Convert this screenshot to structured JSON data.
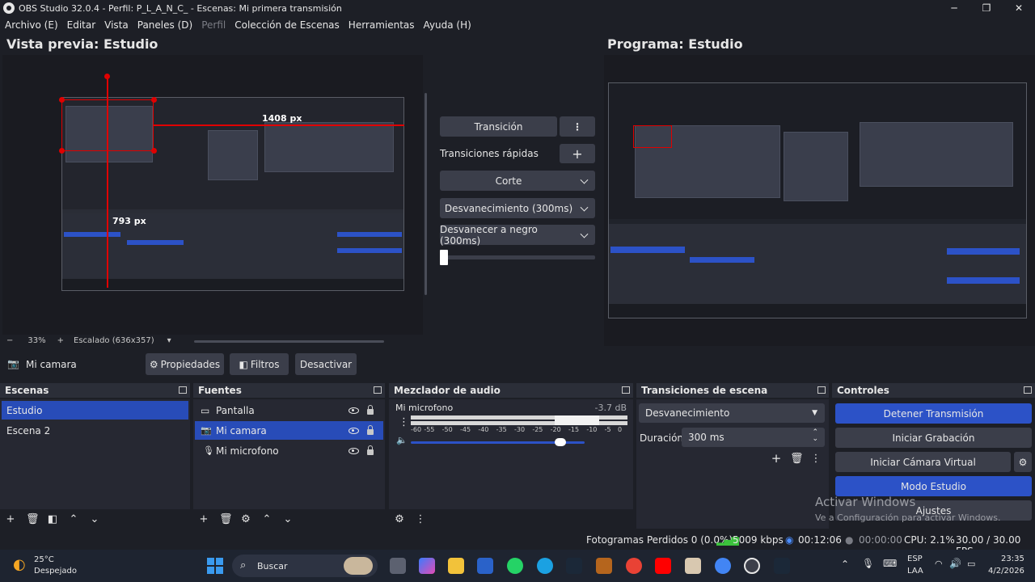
{
  "window": {
    "title": "OBS Studio 32.0.4 - Perfil: P_L_A_N_C_ - Escenas: Mi primera transmisión",
    "min": "─",
    "max": "❐",
    "close": "✕"
  },
  "menu": [
    "Archivo (E)",
    "Editar",
    "Vista",
    "Paneles (D)",
    "Perfil",
    "Colección de Escenas",
    "Herramientas",
    "Ayuda (H)"
  ],
  "preview": {
    "title": "Vista previa: Estudio",
    "width_label": "1408 px",
    "height_label": "793 px",
    "zoom_minus": "−",
    "zoom": "33%",
    "zoom_plus": "+",
    "scale": "Escalado (636x357)"
  },
  "program": {
    "title": "Programa: Estudio"
  },
  "transitions_center": {
    "transition_button": "Transición",
    "quick_label": "Transiciones rápidas",
    "quick": [
      "Corte",
      "Desvanecimiento (300ms)",
      "Desvanecer a negro (300ms)"
    ]
  },
  "source_toolbar": {
    "source_name": "Mi camara",
    "properties": "Propiedades",
    "filters": "Filtros",
    "deactivate": "Desactivar"
  },
  "scenes": {
    "title": "Escenas",
    "items": [
      "Estudio",
      "Escena 2"
    ]
  },
  "sources": {
    "title": "Fuentes",
    "items": [
      "Pantalla",
      "Mi camara",
      "Mi microfono"
    ]
  },
  "mixer": {
    "title": "Mezclador de audio",
    "channel": "Mi microfono",
    "level": "-3.7 dB",
    "ticks": [
      "-60",
      "-55",
      "-50",
      "-45",
      "-40",
      "-35",
      "-30",
      "-25",
      "-20",
      "-15",
      "-10",
      "-5",
      "0"
    ],
    "fader_level": 0.86
  },
  "scene_transitions": {
    "title": "Transiciones de escena",
    "selected": "Desvanecimiento",
    "duration_label": "Duración",
    "duration_value": "300 ms"
  },
  "controls": {
    "title": "Controles",
    "stop_stream": "Detener Transmisión",
    "start_recording": "Iniciar Grabación",
    "start_virtual_cam": "Iniciar Cámara Virtual",
    "studio_mode": "Modo Estudio",
    "settings": "Ajustes"
  },
  "statusbar": {
    "dropped_frames": "Fotogramas Perdidos 0 (0.0%)",
    "bitrate": "5009 kbps",
    "stream_time": "00:12:06",
    "rec_time": "00:00:00",
    "cpu": "CPU: 2.1%",
    "fps": "30.00 / 30.00 FPS"
  },
  "watermark": {
    "line1": "Activar Windows",
    "line2": "Ve a Configuración para activar Windows."
  },
  "taskbar": {
    "weather_temp": "25°C",
    "weather_desc": "Despejado",
    "search": "Buscar",
    "lang1": "ESP",
    "lang2": "LAA",
    "time": "23:35",
    "date": "4/2/2026"
  },
  "colors": {
    "accent": "#2c52c7",
    "selection": "#284cb8",
    "background": "#1d1f26",
    "panel": "#262832",
    "button": "#3b3e4a",
    "guide_red": "#e00000"
  }
}
